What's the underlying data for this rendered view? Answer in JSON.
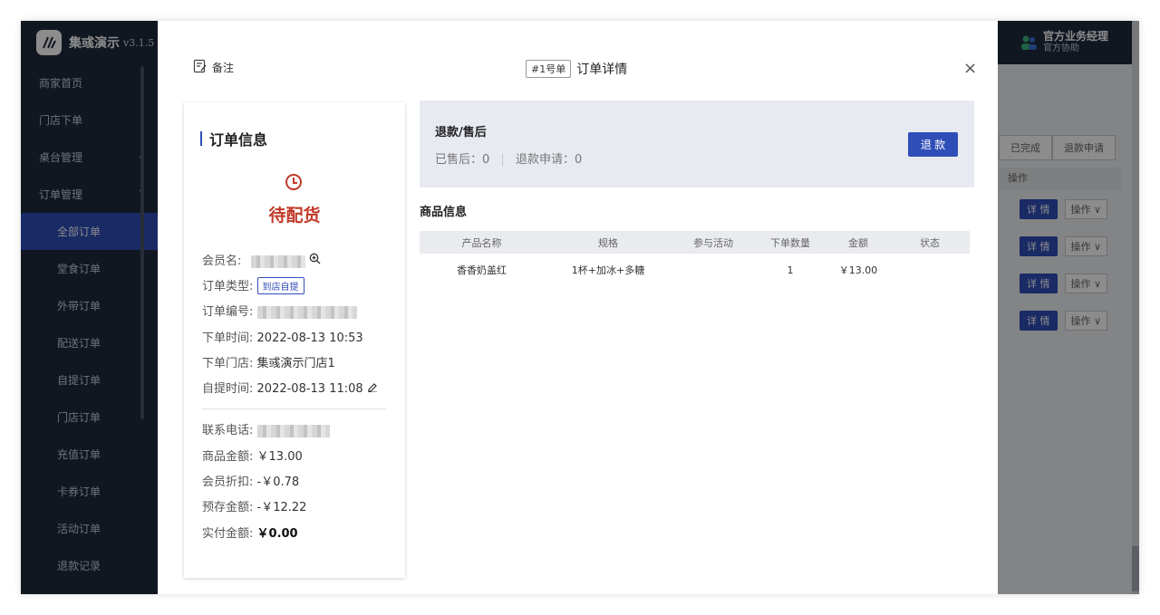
{
  "sidebar": {
    "app_name": "集彧演示",
    "version": "v3.1.5",
    "items": [
      {
        "label": "商家首页"
      },
      {
        "label": "门店下单"
      },
      {
        "label": "桌台管理",
        "chevron": "down"
      },
      {
        "label": "订单管理",
        "chevron": "up"
      },
      {
        "label": "全部订单"
      },
      {
        "label": "堂食订单"
      },
      {
        "label": "外带订单"
      },
      {
        "label": "配送订单"
      },
      {
        "label": "自提订单"
      },
      {
        "label": "门店订单"
      },
      {
        "label": "充值订单"
      },
      {
        "label": "卡券订单"
      },
      {
        "label": "活动订单"
      },
      {
        "label": "退款记录"
      }
    ]
  },
  "account": {
    "name": "官方业务经理",
    "sub": "官方协助"
  },
  "background_table": {
    "tabs": [
      "已完成",
      "退款申请"
    ],
    "op_header": "操作",
    "rows": [
      {
        "detail": "详 情",
        "op": "操作 ∨"
      },
      {
        "detail": "详 情",
        "op": "操作 ∨"
      },
      {
        "detail": "详 情",
        "op": "操作 ∨"
      },
      {
        "detail": "详 情",
        "op": "操作 ∨"
      }
    ]
  },
  "modal": {
    "remark_label": "备注",
    "order_tag": "#1号单",
    "title": "订单详情",
    "close_glyph": "×",
    "order_info": {
      "section_title": "订单信息",
      "status": "待配货",
      "member_label": "会员名:",
      "order_type_label": "订单类型:",
      "order_type_value": "到店自提",
      "order_no_label": "订单编号:",
      "order_time_label": "下单时间:",
      "order_time_value": "2022-08-13 10:53",
      "store_label": "下单门店:",
      "store_value": "集彧演示门店1",
      "pickup_time_label": "自提时间:",
      "pickup_time_value": "2022-08-13 11:08",
      "phone_label": "联系电话:",
      "goods_amount_label": "商品金额:",
      "goods_amount_value": "￥13.00",
      "discount_label": "会员折扣:",
      "discount_value": "-￥0.78",
      "prepaid_label": "预存金额:",
      "prepaid_value": "-￥12.22",
      "paid_label": "实付金额:",
      "paid_value": "￥0.00"
    },
    "refund": {
      "title": "退款/售后",
      "after_sale": "已售后：0",
      "refund_apply": "退款申请：0",
      "button": "退 款"
    },
    "goods": {
      "title": "商品信息",
      "columns": [
        "产品名称",
        "规格",
        "参与活动",
        "下单数量",
        "金额",
        "状态"
      ],
      "rows": [
        {
          "name": "香香奶盖红",
          "spec": "1杯+加冰+多糖",
          "activity": "",
          "qty": "1",
          "amount": "￥13.00",
          "status": ""
        }
      ]
    }
  },
  "colors": {
    "accent": "#2f4eb8",
    "status_red": "#c0392b",
    "sidebar": "#1f2a3c"
  }
}
